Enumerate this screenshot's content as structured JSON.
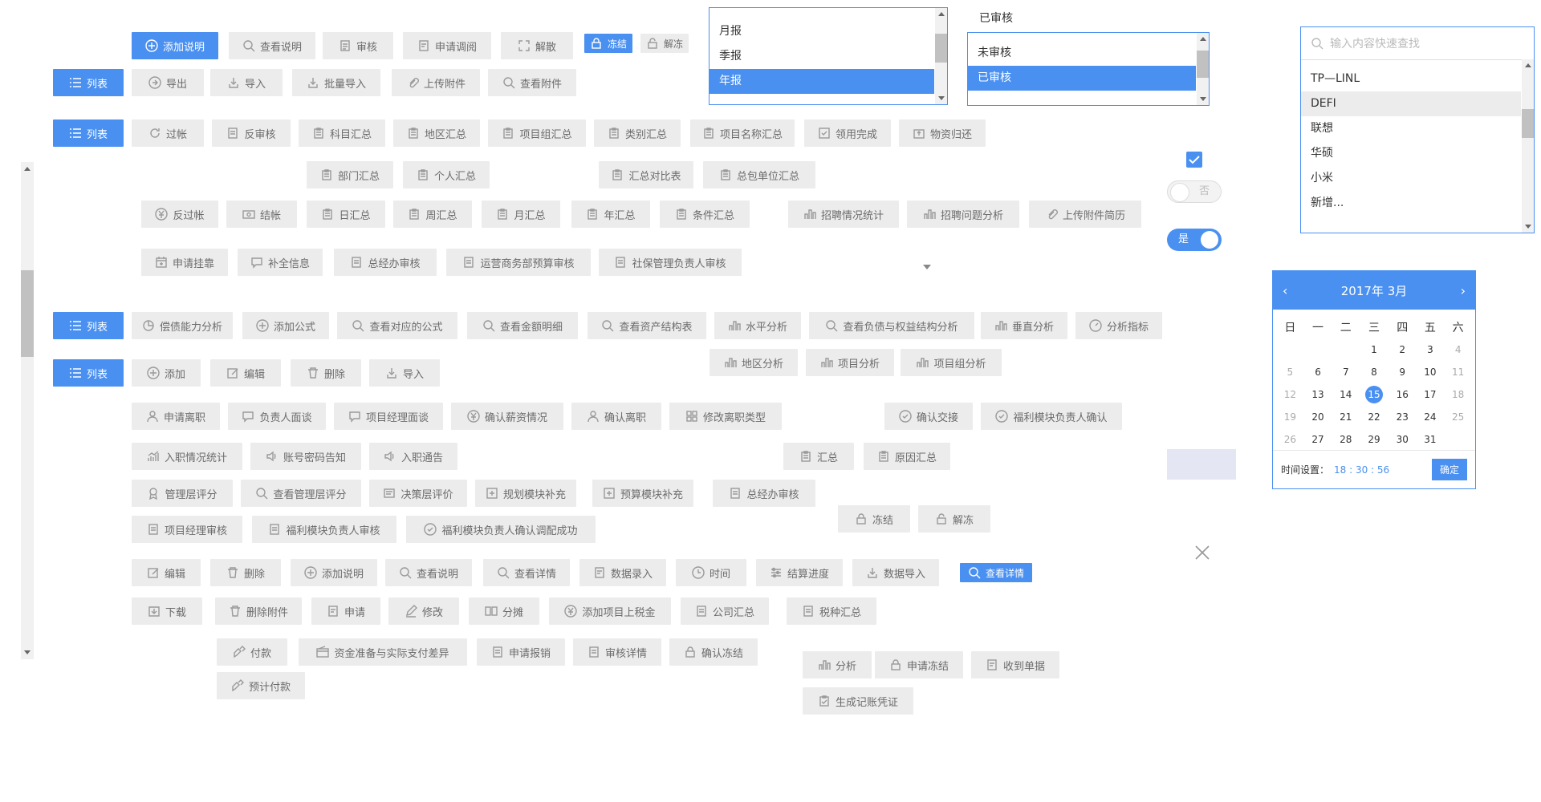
{
  "buttons": {
    "add_note": "添加说明",
    "view_note": "查看说明",
    "audit": "审核",
    "apply_adjust": "申请调阅",
    "dissolve": "解散",
    "freeze": "冻结",
    "unfreeze": "解冻",
    "list": "列表",
    "export": "导出",
    "import": "导入",
    "batch_import": "批量导入",
    "upload_attachment": "上传附件",
    "view_attachment": "查看附件",
    "post": "过帐",
    "reverse_audit": "反审核",
    "subject_summary": "科目汇总",
    "region_summary": "地区汇总",
    "project_group_summary": "项目组汇总",
    "category_summary": "类别汇总",
    "project_name_summary": "项目名称汇总",
    "receive_done": "领用完成",
    "material_return": "物资归还",
    "dept_summary": "部门汇总",
    "person_summary": "个人汇总",
    "summary_compare": "汇总对比表",
    "contractor_summary": "总包单位汇总",
    "reverse_post": "反过帐",
    "settle": "结帐",
    "daily_summary": "日汇总",
    "weekly_summary": "周汇总",
    "monthly_summary": "月汇总",
    "yearly_summary": "年汇总",
    "condition_summary": "条件汇总",
    "recruit_stats": "招聘情况统计",
    "recruit_issue": "招聘问题分析",
    "upload_resume": "上传附件简历",
    "apply_hold": "申请挂靠",
    "supplement_info": "补全信息",
    "gm_audit": "总经办审核",
    "ops_budget_audit": "运营商务部预算审核",
    "social_mgr_audit": "社保管理负责人审核",
    "solvency": "偿债能力分析",
    "add_formula": "添加公式",
    "view_formula": "查看对应的公式",
    "view_amount": "查看金额明细",
    "view_asset": "查看资产结构表",
    "horizontal": "水平分析",
    "view_liability": "查看负债与权益结构分析",
    "vertical": "垂直分析",
    "indicators": "分析指标",
    "region_analysis": "地区分析",
    "project_analysis": "项目分析",
    "project_group_analysis": "项目组分析",
    "add": "添加",
    "edit": "编辑",
    "delete": "删除",
    "apply_leave": "申请离职",
    "lead_interview": "负责人面谈",
    "pm_interview": "项目经理面谈",
    "confirm_salary": "确认薪资情况",
    "confirm_leave": "确认离职",
    "modify_leave_type": "修改离职类型",
    "confirm_handover": "确认交接",
    "welfare_confirm": "福利模块负责人确认",
    "onboard_stats": "入职情况统计",
    "account_notice": "账号密码告知",
    "onboard_notice": "入职通告",
    "summary": "汇总",
    "reason_summary": "原因汇总",
    "mgmt_score": "管理层评分",
    "view_mgmt_score": "查看管理层评分",
    "decision_eval": "决策层评价",
    "plan_supplement": "规划模块补充",
    "budget_supplement": "预算模块补充",
    "pm_audit": "项目经理审核",
    "welfare_audit": "福利模块负责人审核",
    "welfare_success": "福利模块负责人确认调配成功",
    "view_detail": "查看详情",
    "data_entry": "数据录入",
    "time": "时间",
    "settle_progress": "结算进度",
    "data_import": "数据导入",
    "download": "下载",
    "delete_attachment": "删除附件",
    "apply": "申请",
    "modify": "修改",
    "apportion": "分摊",
    "add_project_tax": "添加项目上税金",
    "company_summary": "公司汇总",
    "tax_summary": "税种汇总",
    "payment": "付款",
    "fund_diff": "资金准备与实际支付差异",
    "apply_reimburse": "申请报销",
    "audit_detail": "审核详情",
    "confirm_freeze": "确认冻结",
    "analysis": "分析",
    "apply_freeze": "申请冻结",
    "receive_doc": "收到单据",
    "gen_voucher": "生成记账凭证",
    "prepay": "预计付款"
  },
  "period_list": {
    "options": [
      "月报",
      "季报",
      "年报"
    ],
    "selected": "年报"
  },
  "audit_select": {
    "label": "已审核",
    "options": [
      "未审核",
      "已审核"
    ],
    "selected": "已审核"
  },
  "brand_select": {
    "placeholder": "输入内容快速查找",
    "options": [
      "TP—LINL",
      "DEFI",
      "联想",
      "华硕",
      "小米",
      "新增..."
    ]
  },
  "toggles": {
    "off_label": "否",
    "on_label": "是"
  },
  "calendar": {
    "title": "2017年 3月",
    "weekdays": [
      "日",
      "一",
      "二",
      "三",
      "四",
      "五",
      "六"
    ],
    "today": "15",
    "time_label": "时间设置：",
    "time_value": "18 : 30 : 56",
    "confirm": "确定"
  },
  "colors": {
    "accent": "#4a90f0",
    "button_bg": "#ececec",
    "text_muted": "#6b6b6b"
  }
}
